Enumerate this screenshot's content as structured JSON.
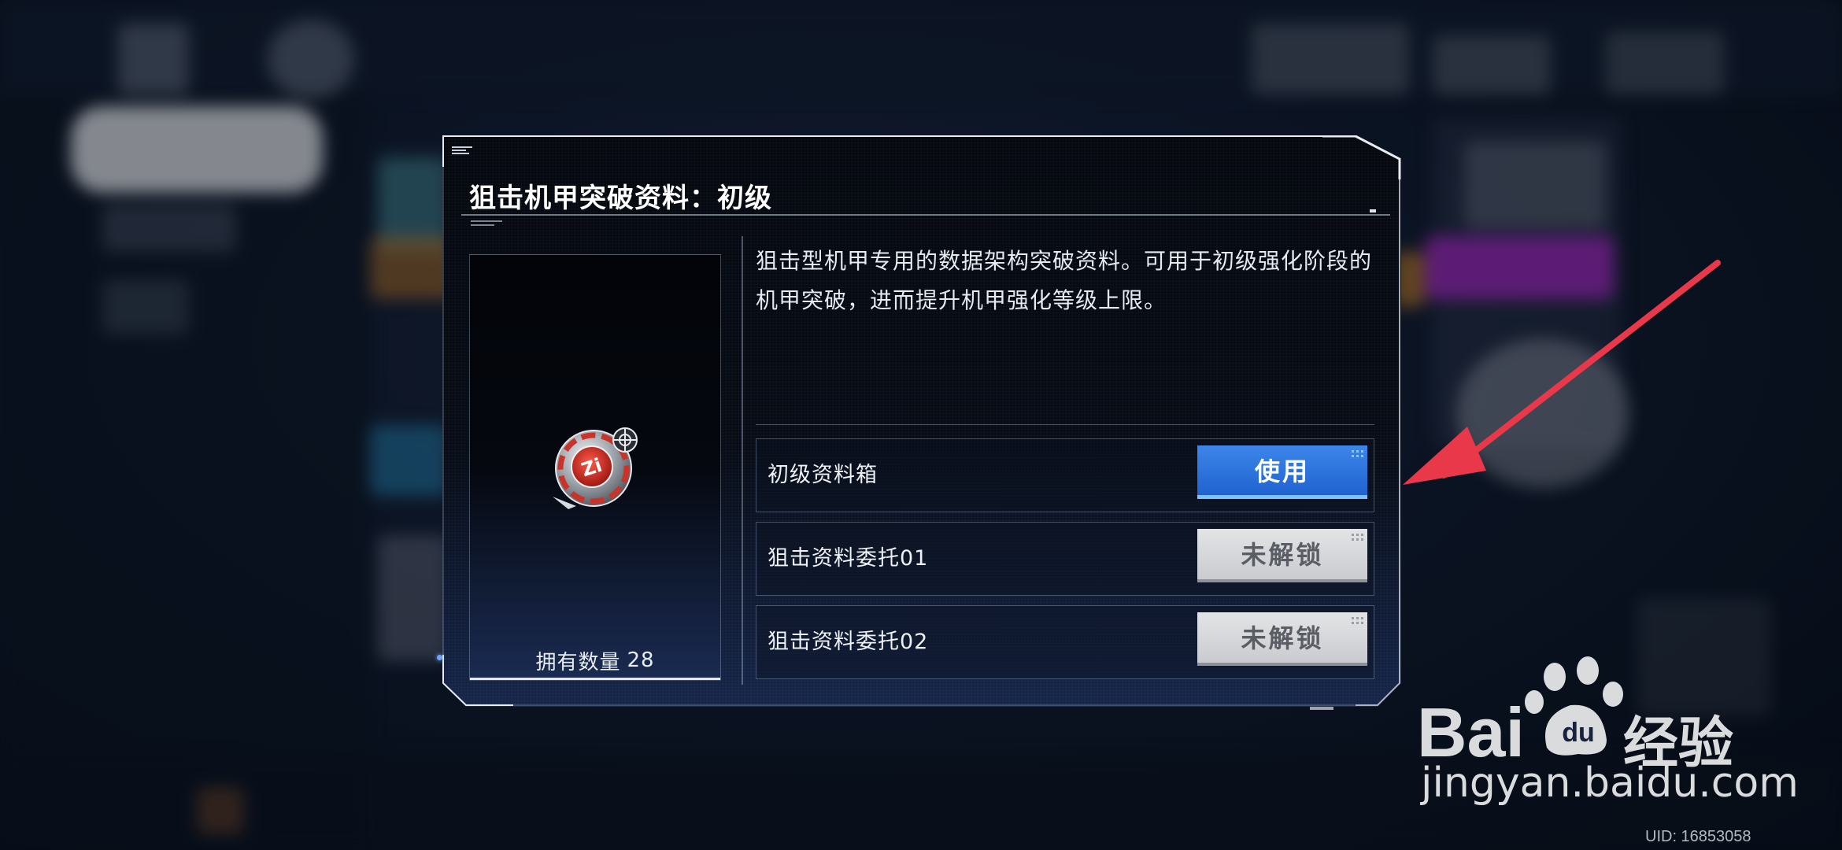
{
  "dialog": {
    "title": "狙击机甲突破资料：初级",
    "description": "狙击型机甲专用的数据架构突破资料。可用于初级强化阶段的机甲突破，进而提升机甲强化等级上限。",
    "owned": {
      "label": "拥有数量",
      "count": "28"
    },
    "item_icon": "sniper-mech-breakthrough-chip-icon",
    "sources": [
      {
        "label": "初级资料箱",
        "button": "使用",
        "state": "enabled"
      },
      {
        "label": "狙击资料委托01",
        "button": "未解锁",
        "state": "locked"
      },
      {
        "label": "狙击资料委托02",
        "button": "未解锁",
        "state": "locked"
      }
    ]
  },
  "overlay": {
    "arrow_color": "#e8384a"
  },
  "watermark": {
    "brand": "Bai",
    "brand_suffix": "du",
    "cn": "经验",
    "url": "jingyan.baidu.com"
  },
  "footer": {
    "uid": "UID: 16853058"
  },
  "colors": {
    "use_button": "#2a6fdc",
    "locked_button": "#d4d5d8"
  }
}
